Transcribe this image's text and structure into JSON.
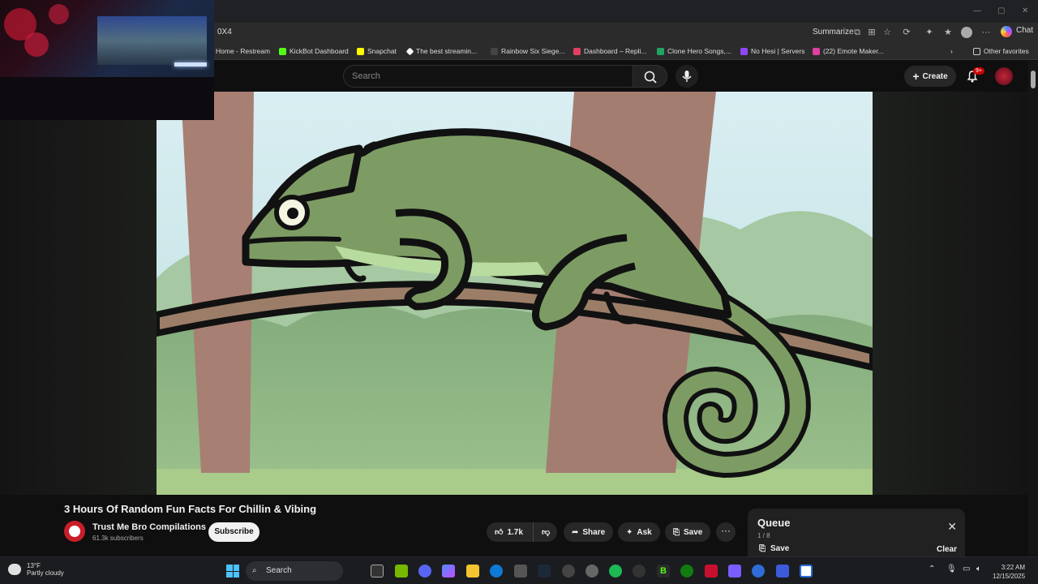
{
  "browser": {
    "url": "0X4",
    "summarize_label": "Summarize",
    "chat_label": "Chat",
    "bookmarks": [
      {
        "label": "Home - Restream",
        "color": "#3ea6ff"
      },
      {
        "label": "KickBot Dashboard",
        "color": "#53fc18"
      },
      {
        "label": "Snapchat",
        "color": "#fffc00"
      },
      {
        "label": "The best streamin...",
        "color": "#ffffff"
      },
      {
        "label": "Rainbow Six Siege...",
        "color": "#dddddd"
      },
      {
        "label": "Dashboard – Repli...",
        "color": "#e04060"
      },
      {
        "label": "Clone Hero Songs,...",
        "color": "#20a464"
      },
      {
        "label": "No Hesi | Servers",
        "color": "#9146ff"
      },
      {
        "label": "(22) Emote Maker...",
        "color": "#e040a0"
      }
    ],
    "other_favorites": "Other favorites"
  },
  "youtube": {
    "search_placeholder": "Search",
    "create_label": "Create",
    "notif_badge": "9+"
  },
  "video": {
    "title": "3 Hours Of Random Fun Facts For Chillin & Vibing",
    "channel": "Trust Me Bro Compilations",
    "subscribers": "61.3k subscribers",
    "subscribe_label": "Subscribe",
    "likes": "1.7k",
    "share_label": "Share",
    "ask_label": "Ask",
    "save_label": "Save",
    "more_label": "···"
  },
  "queue": {
    "title": "Queue",
    "count": "1 / 8",
    "save_label": "Save",
    "clear_label": "Clear"
  },
  "taskbar": {
    "temp": "13°F",
    "weather": "Partly cloudy",
    "search_label": "Search",
    "time": "3:22 AM",
    "date": "12/15/2025"
  },
  "colors": {
    "chameleon": "#7d9c64",
    "branch": "#a07e68",
    "sky": "#cfe8ee",
    "tree": "#a47e72",
    "bush": "#8fb38a"
  }
}
